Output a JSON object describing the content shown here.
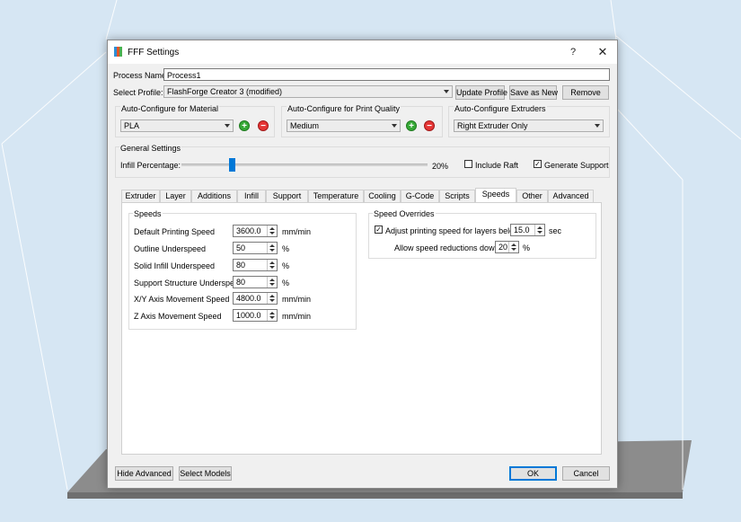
{
  "window": {
    "title": "FFF Settings",
    "help_glyph": "?",
    "close_glyph": "✕"
  },
  "process": {
    "label": "Process Name:",
    "value": "Process1"
  },
  "profile": {
    "label": "Select Profile:",
    "selected": "FlashForge Creator 3 (modified)",
    "update_button": "Update Profile",
    "save_button": "Save as New",
    "remove_button": "Remove"
  },
  "auto_material": {
    "title": "Auto-Configure for Material",
    "selected": "PLA"
  },
  "auto_quality": {
    "title": "Auto-Configure for Print Quality",
    "selected": "Medium"
  },
  "auto_extruders": {
    "title": "Auto-Configure Extruders",
    "selected": "Right Extruder Only"
  },
  "general": {
    "title": "General Settings",
    "infill_label": "Infill Percentage:",
    "infill_value": "20%",
    "infill_fraction": 0.2,
    "include_raft_label": "Include Raft",
    "include_raft_checked": false,
    "generate_support_label": "Generate Support",
    "generate_support_checked": true
  },
  "tabs": [
    {
      "label": "Extruder"
    },
    {
      "label": "Layer"
    },
    {
      "label": "Additions"
    },
    {
      "label": "Infill"
    },
    {
      "label": "Support"
    },
    {
      "label": "Temperature"
    },
    {
      "label": "Cooling"
    },
    {
      "label": "G-Code"
    },
    {
      "label": "Scripts"
    },
    {
      "label": "Speeds"
    },
    {
      "label": "Other"
    },
    {
      "label": "Advanced"
    }
  ],
  "active_tab": "Speeds",
  "speeds": {
    "title": "Speeds",
    "rows": [
      {
        "label": "Default Printing Speed",
        "value": "3600.0",
        "unit": "mm/min"
      },
      {
        "label": "Outline Underspeed",
        "value": "50",
        "unit": "%"
      },
      {
        "label": "Solid Infill Underspeed",
        "value": "80",
        "unit": "%"
      },
      {
        "label": "Support Structure Underspeed",
        "value": "80",
        "unit": "%"
      },
      {
        "label": "X/Y Axis Movement Speed",
        "value": "4800.0",
        "unit": "mm/min"
      },
      {
        "label": "Z Axis Movement Speed",
        "value": "1000.0",
        "unit": "mm/min"
      }
    ]
  },
  "overrides": {
    "title": "Speed Overrides",
    "adjust_label": "Adjust printing speed for layers below",
    "adjust_checked": true,
    "adjust_value": "15.0",
    "adjust_unit": "sec",
    "allow_label": "Allow speed reductions down to",
    "allow_value": "20",
    "allow_unit": "%"
  },
  "footer": {
    "hide_advanced": "Hide Advanced",
    "select_models": "Select Models",
    "ok": "OK",
    "cancel": "Cancel"
  },
  "colors": {
    "accent": "#0078d7",
    "plus": "#36a936",
    "minus": "#e53535"
  }
}
